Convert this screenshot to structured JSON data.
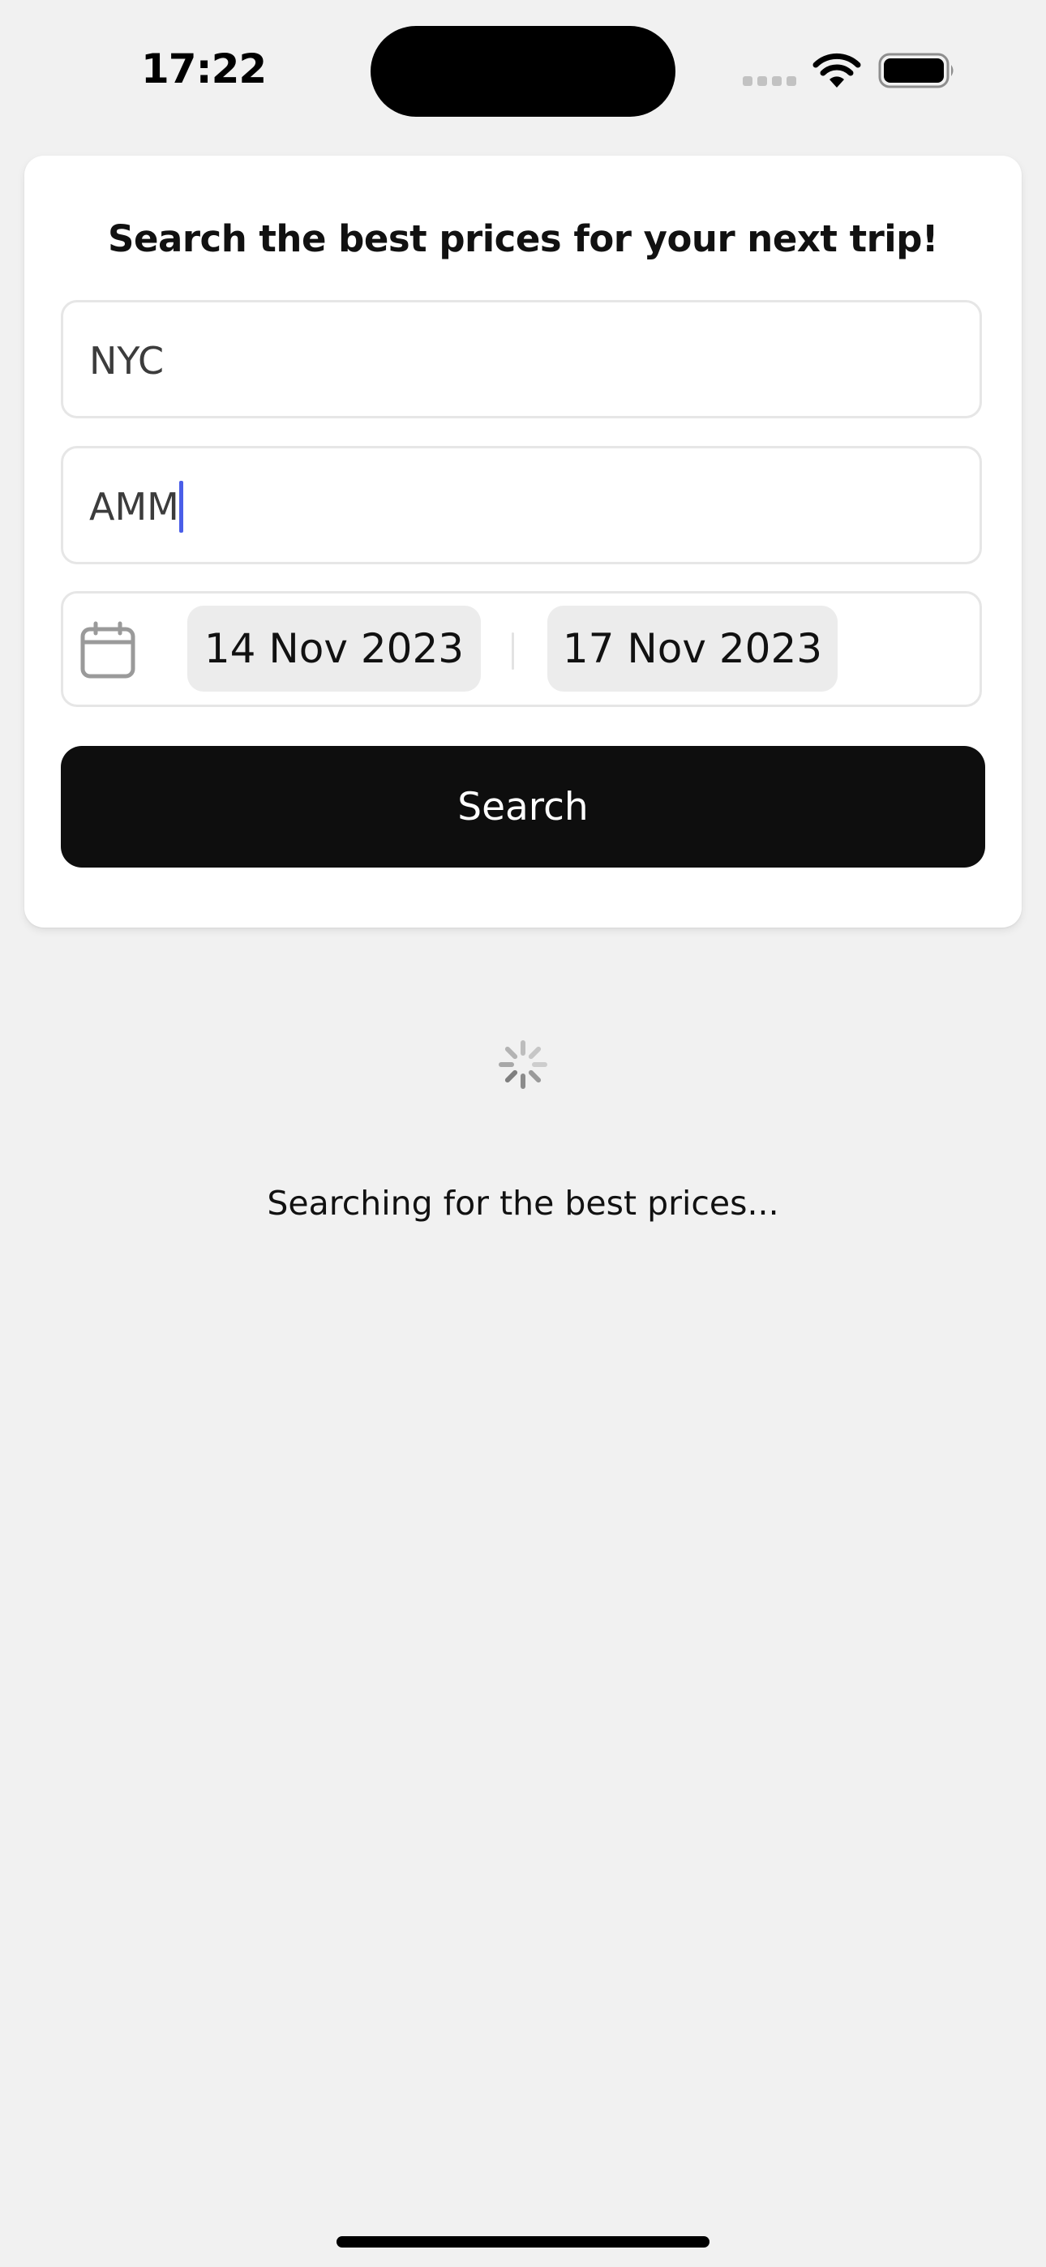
{
  "status_bar": {
    "time": "17:22",
    "icons": [
      "signal-icon",
      "wifi-icon",
      "battery-icon"
    ]
  },
  "search_form": {
    "title": "Search the best prices for your next trip!",
    "origin": {
      "value": "NYC"
    },
    "destination": {
      "value": "AMM"
    },
    "dates": {
      "icon": "calendar-icon",
      "start": "14 Nov 2023",
      "end": "17 Nov 2023"
    },
    "search_button_label": "Search"
  },
  "loading": {
    "icon": "spinner-icon",
    "message": "Searching for the best prices..."
  },
  "colors": {
    "background": "#f1f1f1",
    "card": "#ffffff",
    "button": "#0e0e0e",
    "cursor": "#4a5ee8",
    "chip": "#ececec"
  }
}
